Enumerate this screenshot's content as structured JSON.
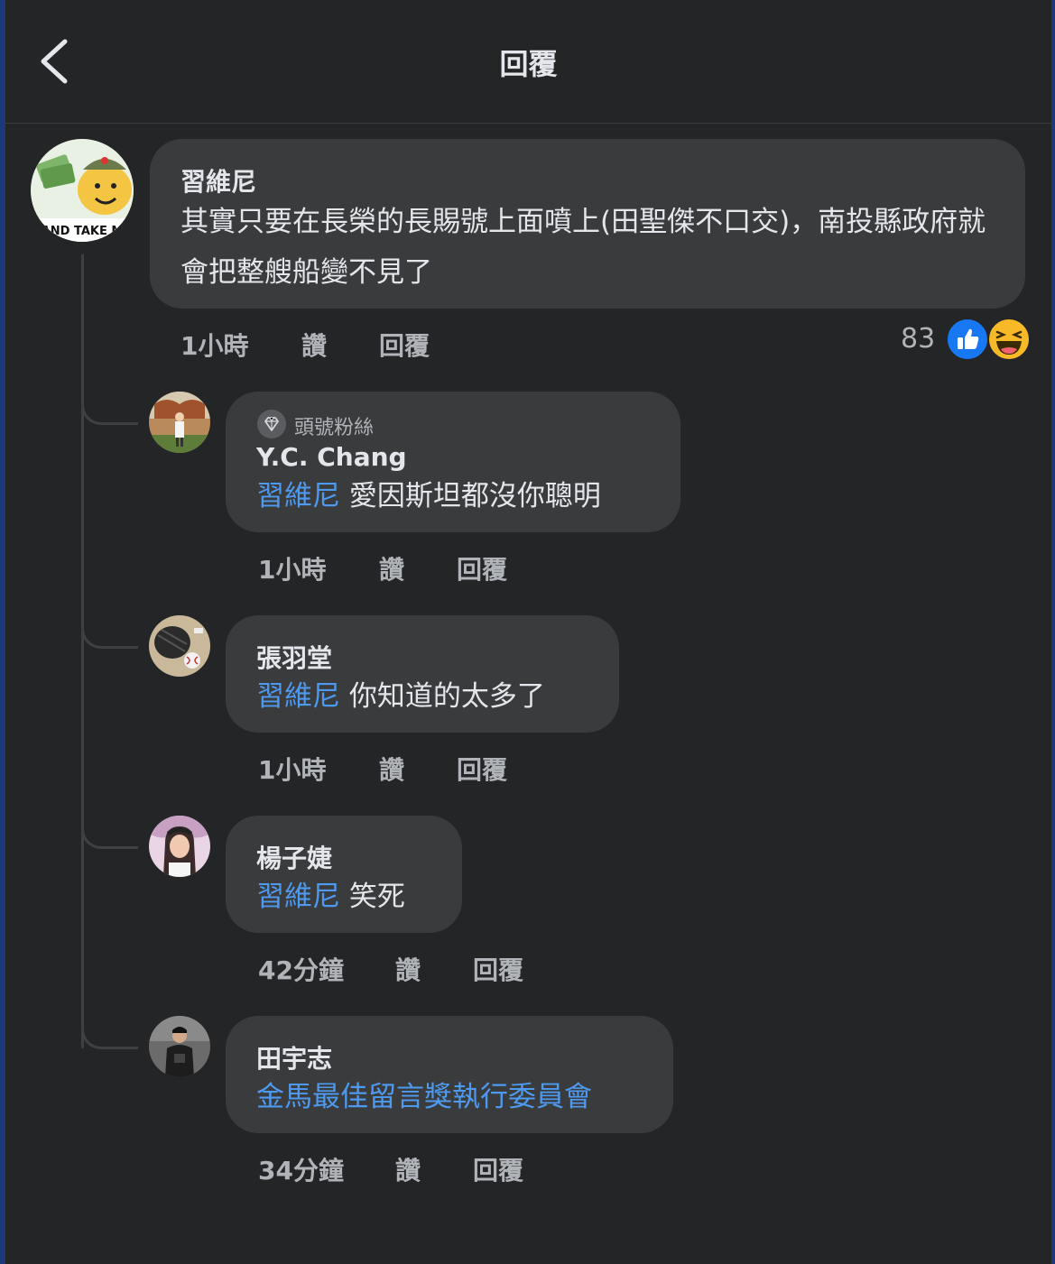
{
  "header": {
    "title": "回覆",
    "back_icon": "chevron-left-icon"
  },
  "main_comment": {
    "author": "習維尼",
    "avatar_badge_text": "AND TAKE M",
    "text": "其實只要在長榮的長賜號上面噴上(田聖傑不口交)，南投縣政府就會把整艘船變不見了",
    "time": "1小時",
    "like_label": "讚",
    "reply_label": "回覆",
    "reaction_count": "83",
    "reactions": [
      "like-icon",
      "haha-icon"
    ]
  },
  "replies": [
    {
      "badge": "頭號粉絲",
      "author": "Y.C. Chang",
      "mention": "習維尼",
      "text": " 愛因斯坦都沒你聰明",
      "time": "1小時",
      "like_label": "讚",
      "reply_label": "回覆"
    },
    {
      "author": "張羽堂",
      "mention": "習維尼",
      "text": " 你知道的太多了",
      "time": "1小時",
      "like_label": "讚",
      "reply_label": "回覆"
    },
    {
      "author": "楊子婕",
      "mention": "習維尼",
      "text": " 笑死",
      "time": "42分鐘",
      "like_label": "讚",
      "reply_label": "回覆"
    },
    {
      "author": "田宇志",
      "mention": "金馬最佳留言獎執行委員會",
      "text": "",
      "time": "34分鐘",
      "like_label": "讚",
      "reply_label": "回覆"
    }
  ],
  "colors": {
    "background": "#242526",
    "bubble": "#3a3b3c",
    "mention": "#4e9af1",
    "meta": "#b0b3b8",
    "like_blue": "#1877f2",
    "haha_yellow": "#f7b928"
  }
}
